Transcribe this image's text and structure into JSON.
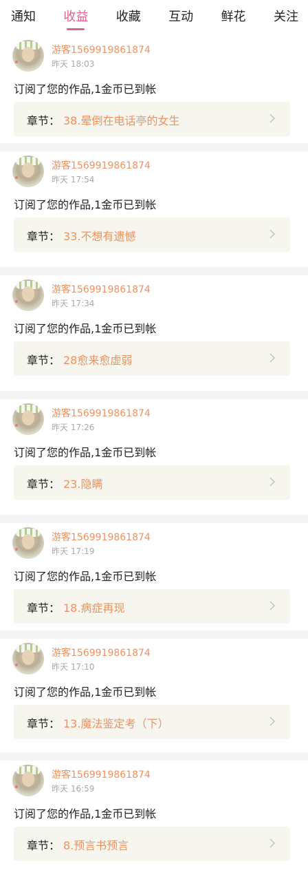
{
  "tabs": [
    {
      "label": "通知",
      "active": false
    },
    {
      "label": "收益",
      "active": true
    },
    {
      "label": "收藏",
      "active": false
    },
    {
      "label": "互动",
      "active": false
    },
    {
      "label": "鲜花",
      "active": false
    },
    {
      "label": "关注",
      "active": false
    }
  ],
  "colors": {
    "accent_pink": "#e2608e",
    "accent_orange": "#f0915d",
    "separator": "#f4f4f4",
    "chapter_bg": "#f6f5ee"
  },
  "common": {
    "message": "订阅了您的作品,1金币已到帐",
    "chapter_label": "章节：",
    "avatar_icon": "user-avatar",
    "chevron_icon": "chevron-right-icon"
  },
  "items": [
    {
      "username": "游客1569919861874",
      "time": "昨天 18:03",
      "chapter": "38.晕倒在电话亭的女生"
    },
    {
      "username": "游客1569919861874",
      "time": "昨天 17:54",
      "chapter": "33.不想有遗憾"
    },
    {
      "username": "游客1569919861874",
      "time": "昨天 17:34",
      "chapter": "28愈来愈虚弱"
    },
    {
      "username": "游客1569919861874",
      "time": "昨天 17:26",
      "chapter": "23.隐瞒"
    },
    {
      "username": "游客1569919861874",
      "time": "昨天 17:19",
      "chapter": "18.病症再现"
    },
    {
      "username": "游客1569919861874",
      "time": "昨天 17:10",
      "chapter": "13.魔法鉴定考（下）"
    },
    {
      "username": "游客1569919861874",
      "time": "昨天 16:59",
      "chapter": "8.预言书预言"
    }
  ]
}
